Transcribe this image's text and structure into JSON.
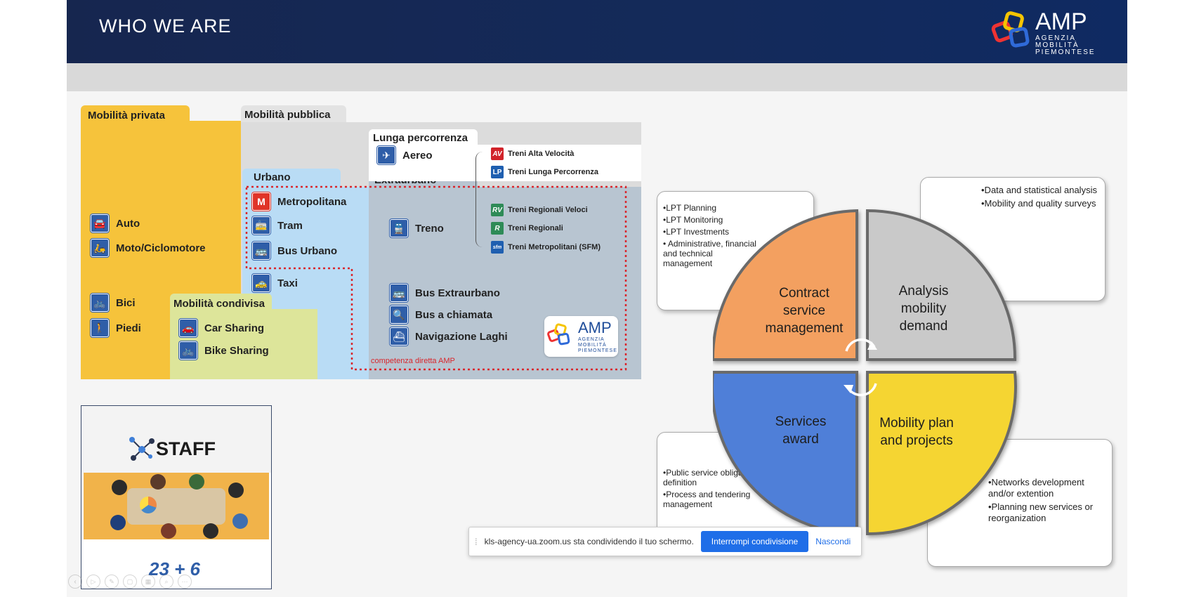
{
  "slide": {
    "title": "WHO WE ARE",
    "logo": {
      "text": "AMP",
      "sub": [
        "AGENZIA",
        "MOBILITÀ",
        "PIEMONTESE"
      ]
    }
  },
  "mobility": {
    "privata_label": "Mobilità privata",
    "pubblica_label": "Mobilità pubblica",
    "lunga_label": "Lunga percorrenza",
    "urbano_label": "Urbano",
    "extraurbano_label": "Extraurbano",
    "condivisa_label": "Mobilità condivisa",
    "privata_items": [
      {
        "label": "Auto",
        "icon": "car-icon"
      },
      {
        "label": "Moto/Ciclomotore",
        "icon": "scooter-icon"
      },
      {
        "label": "Bici",
        "icon": "bike-icon"
      },
      {
        "label": "Piedi",
        "icon": "walk-icon"
      }
    ],
    "urbano_items": [
      {
        "label": "Metropolitana",
        "icon": "metro-icon"
      },
      {
        "label": "Tram",
        "icon": "tram-icon"
      },
      {
        "label": "Bus Urbano",
        "icon": "bus-icon"
      },
      {
        "label": "Taxi",
        "icon": "taxi-icon"
      }
    ],
    "aereo": "Aereo",
    "treno": "Treno",
    "extra_items": [
      {
        "label": "Bus Extraurbano",
        "icon": "bus-icon"
      },
      {
        "label": "Bus a chiamata",
        "icon": "bus-on-demand-icon"
      },
      {
        "label": "Navigazione Laghi",
        "icon": "ferry-icon"
      }
    ],
    "condivisa_items": [
      {
        "label": "Car Sharing",
        "icon": "car-sharing-icon"
      },
      {
        "label": "Bike Sharing",
        "icon": "bike-sharing-icon"
      }
    ],
    "trains": [
      {
        "code": "AV",
        "label": "Treni Alta Velocità",
        "color": "#d1232a"
      },
      {
        "code": "LP",
        "label": "Treni Lunga Percorrenza",
        "color": "#1f5fb0"
      },
      {
        "code": "RV",
        "label": "Treni Regionali Veloci",
        "color": "#2e8b57"
      },
      {
        "code": "R",
        "label": "Treni Regionali",
        "color": "#2e8b57"
      },
      {
        "code": "sfm",
        "label": "Treni Metropolitani (SFM)",
        "color": "#1f5fb0"
      }
    ],
    "competenza": "competenza diretta AMP"
  },
  "staff": {
    "title": "STAFF",
    "count": "23 + 6"
  },
  "diagram": {
    "quadrants": {
      "tl": "Contract service management",
      "tr": "Analysis mobility demand",
      "bl": "Services award",
      "br": "Mobility  plan and projects"
    },
    "boxes": {
      "tl": [
        "•LPT Planning",
        "•LPT Monitoring",
        "•LPT Investments",
        "• Administrative, financial and technical management"
      ],
      "tr": [
        "•Data and statistical analysis",
        "•Mobility and quality surveys"
      ],
      "bl": [
        "•Public service obligatio definition",
        "•Process and tendering management"
      ],
      "br": [
        "•Networks development and/or extention",
        "•Planning new services or reorganization"
      ]
    },
    "colors": {
      "orange": "#f3a061",
      "grey": "#c9c9c9",
      "blue": "#4f7fd8",
      "yellow": "#f5d531"
    }
  },
  "zoom_share": {
    "message": "kls-agency-ua.zoom.us sta condividendo il tuo schermo.",
    "stop_label": "Interrompi condivisione",
    "hide_label": "Nascondi"
  }
}
